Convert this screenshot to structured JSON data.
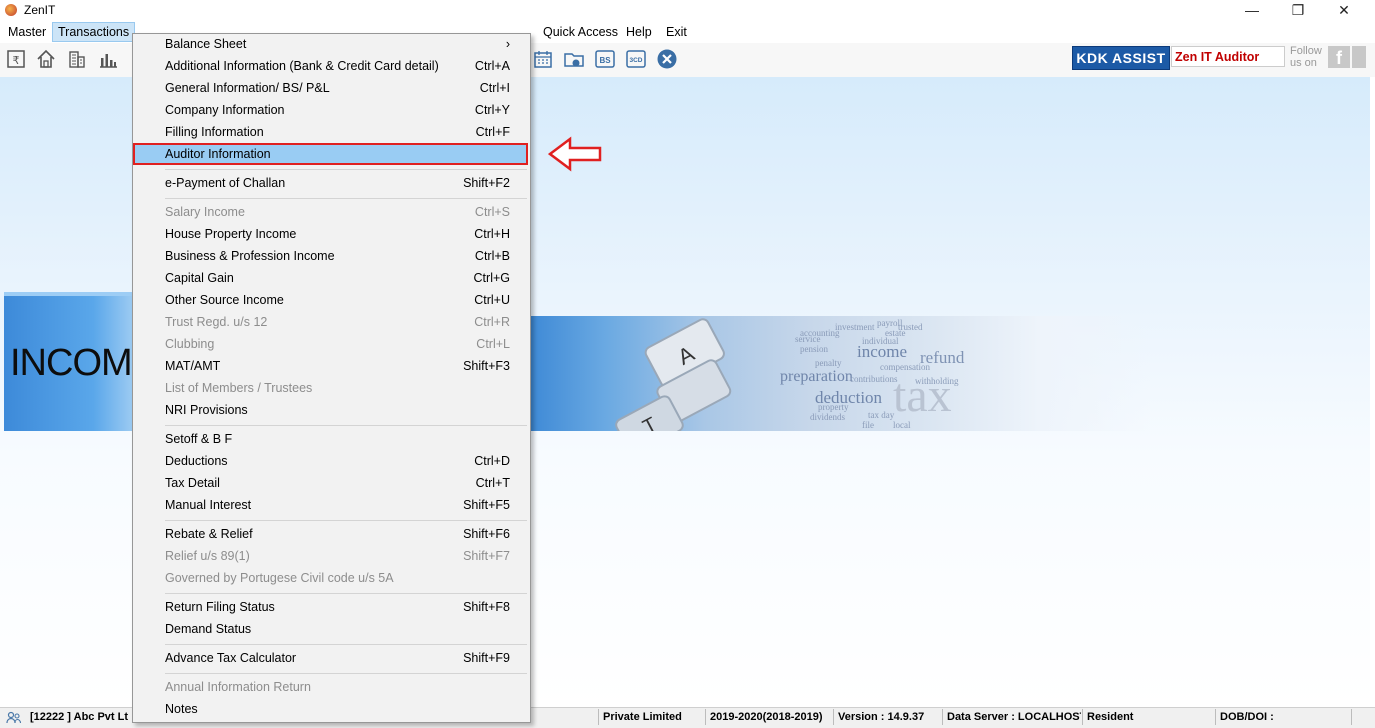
{
  "window": {
    "title": "ZenIT",
    "controls": {
      "minimize": "—",
      "maximize": "❐",
      "close": "✕"
    }
  },
  "menubar": {
    "items": [
      {
        "label": "Master"
      },
      {
        "label": "Transactions"
      },
      {
        "label": "Quick Access"
      },
      {
        "label": "Help"
      },
      {
        "label": "Exit"
      }
    ],
    "active_index": 1
  },
  "toolbar": {
    "kdk_assist_label": "KDK ASSIST",
    "auditor_label": "Zen IT Auditor",
    "follow_line1": "Follow",
    "follow_line2": "us on",
    "facebook_glyph": "f",
    "icons": [
      "rupee-doc-icon",
      "home-icon",
      "building-icon",
      "bar-chart-icon",
      "calendar-icon",
      "folder-icon",
      "bs-icon",
      "3cd-icon",
      "close-circle-icon"
    ],
    "bs_text": "BS",
    "cd3_text": "3CD"
  },
  "banner": {
    "income_text": "INCOME",
    "keyboard_letters": [
      "A",
      "T"
    ],
    "words": [
      "payroll",
      "investment",
      "accounting",
      "income",
      "refund",
      "individual",
      "pension",
      "penalty",
      "compensation",
      "preparation",
      "deduction",
      "contributions",
      "withholding",
      "dividends",
      "tax",
      "property",
      "tax day",
      "local",
      "file",
      "service",
      "estate",
      "trusted"
    ]
  },
  "dropdown": {
    "items": [
      {
        "label": "Balance Sheet",
        "shortcut": "›",
        "disabled": false
      },
      {
        "label": "Additional Information (Bank & Credit Card detail)",
        "shortcut": "Ctrl+A",
        "disabled": false
      },
      {
        "label": "General Information/ BS/ P&L",
        "shortcut": "Ctrl+I",
        "disabled": false
      },
      {
        "label": "Company Information",
        "shortcut": "Ctrl+Y",
        "disabled": false
      },
      {
        "label": "Filling Information",
        "shortcut": "Ctrl+F",
        "disabled": false
      },
      {
        "label": "Auditor Information",
        "shortcut": "",
        "disabled": false,
        "highlighted": true
      },
      {
        "label": "e-Payment of Challan",
        "shortcut": "Shift+F2",
        "disabled": false
      },
      {
        "label": "Salary Income",
        "shortcut": "Ctrl+S",
        "disabled": true
      },
      {
        "label": "House Property Income",
        "shortcut": "Ctrl+H",
        "disabled": false
      },
      {
        "label": "Business & Profession Income",
        "shortcut": "Ctrl+B",
        "disabled": false
      },
      {
        "label": "Capital Gain",
        "shortcut": "Ctrl+G",
        "disabled": false
      },
      {
        "label": "Other Source Income",
        "shortcut": "Ctrl+U",
        "disabled": false
      },
      {
        "label": "Trust Regd. u/s 12",
        "shortcut": "Ctrl+R",
        "disabled": true
      },
      {
        "label": "Clubbing",
        "shortcut": "Ctrl+L",
        "disabled": true
      },
      {
        "label": "MAT/AMT",
        "shortcut": "Shift+F3",
        "disabled": false
      },
      {
        "label": "List of Members / Trustees",
        "shortcut": "",
        "disabled": true
      },
      {
        "label": "NRI Provisions",
        "shortcut": "",
        "disabled": false
      },
      {
        "label": "Setoff & B F",
        "shortcut": "",
        "disabled": false
      },
      {
        "label": "Deductions",
        "shortcut": "Ctrl+D",
        "disabled": false
      },
      {
        "label": "Tax Detail",
        "shortcut": "Ctrl+T",
        "disabled": false
      },
      {
        "label": "Manual Interest",
        "shortcut": "Shift+F5",
        "disabled": false
      },
      {
        "label": "Rebate & Relief",
        "shortcut": "Shift+F6",
        "disabled": false
      },
      {
        "label": "Relief u/s 89(1)",
        "shortcut": "Shift+F7",
        "disabled": true
      },
      {
        "label": "Governed by Portugese Civil code u/s 5A",
        "shortcut": "",
        "disabled": true
      },
      {
        "label": "Return Filing Status",
        "shortcut": "Shift+F8",
        "disabled": false
      },
      {
        "label": "Demand Status",
        "shortcut": "",
        "disabled": false
      },
      {
        "label": "Advance Tax Calculator",
        "shortcut": "Shift+F9",
        "disabled": false
      },
      {
        "label": "Annual Information Return",
        "shortcut": "",
        "disabled": true
      },
      {
        "label": "Notes",
        "shortcut": "",
        "disabled": false
      }
    ]
  },
  "statusbar": {
    "client": "[12222 ] Abc Pvt Lt",
    "status": "Private Limited",
    "assessment_year": "2019-2020(2018-2019)",
    "version": "Version : 14.9.37",
    "data_server": "Data Server : LOCALHOST",
    "residency": "Resident",
    "dob": "DOB/DOI :"
  },
  "colors": {
    "accent_blue": "#1c5aa6",
    "highlight": "#99ccf3",
    "callout_red": "#e02020",
    "auditor_red": "#c00000"
  }
}
